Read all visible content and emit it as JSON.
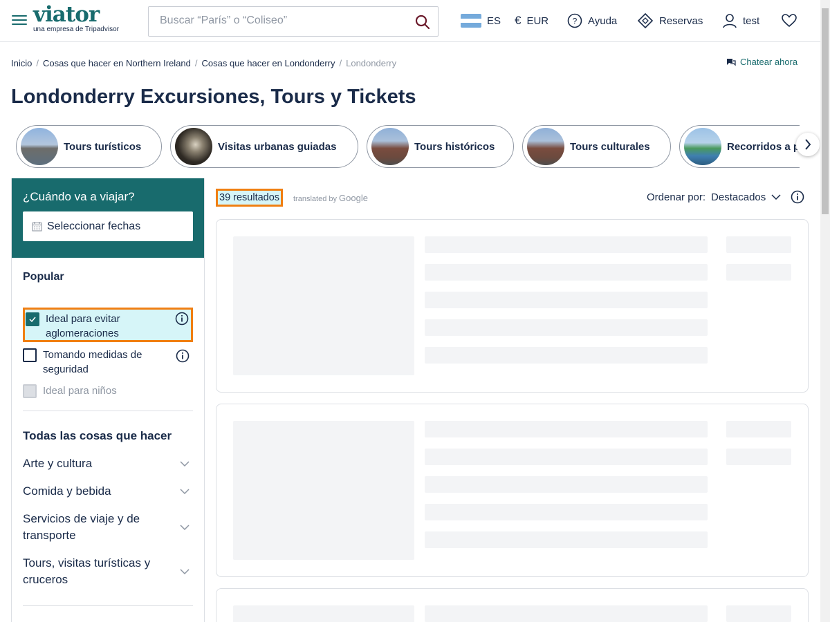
{
  "header": {
    "logo": "viator",
    "logo_tagline": "una empresa de Tripadvisor",
    "search_placeholder": "Buscar “París” o “Coliseo”",
    "language": "ES",
    "currency": "EUR",
    "help": "Ayuda",
    "bookings": "Reservas",
    "user": "test"
  },
  "breadcrumb": {
    "items": [
      "Inicio",
      "Cosas que hacer en Northern Ireland",
      "Cosas que hacer en Londonderry"
    ],
    "current": "Londonderry"
  },
  "chat_label": "Chatear ahora",
  "page_title": "Londonderry Excursiones, Tours y Tickets",
  "categories": [
    "Tours turísticos",
    "Visitas urbanas guiadas",
    "Tours históricos",
    "Tours culturales",
    "Recorridos a p"
  ],
  "sidebar": {
    "when_label": "¿Cuándo va a viajar?",
    "date_placeholder": "Seleccionar fechas",
    "popular_title": "Popular",
    "popular_filters": [
      {
        "label": "Ideal para evitar aglomeraciones",
        "checked": true
      },
      {
        "label": "Tomando medidas de seguridad",
        "checked": false
      },
      {
        "label": "Ideal para niños",
        "checked": false,
        "disabled": true
      }
    ],
    "all_title": "Todas las cosas que hacer",
    "all_filters": [
      "Arte y cultura",
      "Comida y bebida",
      "Servicios de viaje y de transporte",
      "Tours, visitas turísticas y cruceros"
    ]
  },
  "results": {
    "count": "39 resultados",
    "translated_by": "translated by",
    "google": "Google",
    "sort_label": "Ordenar por:",
    "sort_value": "Destacados"
  },
  "colors": {
    "brand": "#186b6d",
    "highlight_border": "#f07f12",
    "highlight_fill": "#d6f5f8",
    "text": "#1a2b49"
  }
}
